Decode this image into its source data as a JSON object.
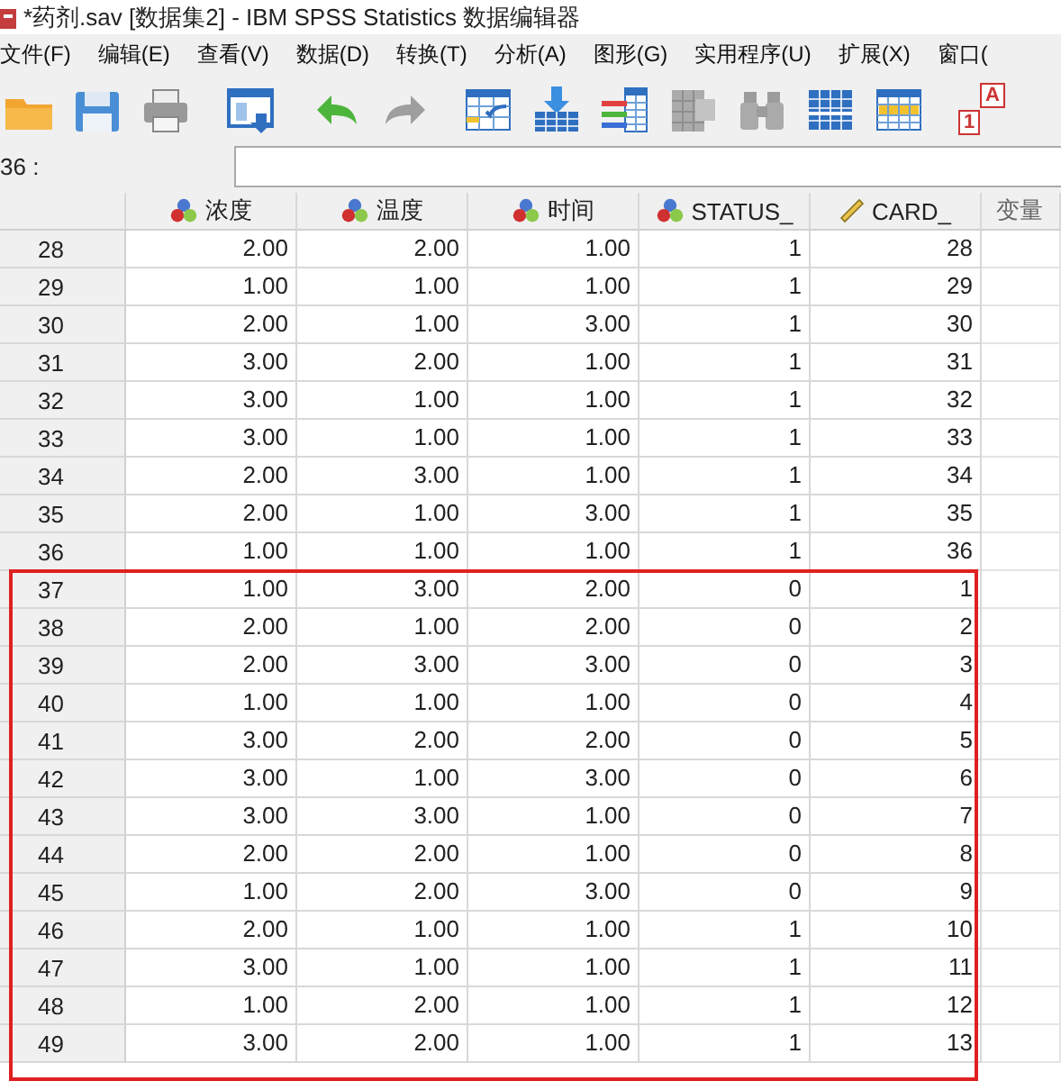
{
  "window": {
    "title": "*药剂.sav [数据集2] - IBM SPSS Statistics 数据编辑器"
  },
  "menu": [
    "文件(F)",
    "编辑(E)",
    "查看(V)",
    "数据(D)",
    "转换(T)",
    "分析(A)",
    "图形(G)",
    "实用程序(U)",
    "扩展(X)",
    "窗口("
  ],
  "toolbar": [
    {
      "kind": "folder",
      "disabled": false
    },
    {
      "kind": "save",
      "disabled": false
    },
    {
      "kind": "print",
      "disabled": false
    },
    {
      "kind": "dialog",
      "disabled": false
    },
    {
      "kind": "undo",
      "disabled": false
    },
    {
      "kind": "redo",
      "disabled": true
    },
    {
      "kind": "goto-case",
      "disabled": false
    },
    {
      "kind": "goto-variable",
      "disabled": false
    },
    {
      "kind": "variables",
      "disabled": false
    },
    {
      "kind": "grid",
      "disabled": true
    },
    {
      "kind": "binoculars",
      "disabled": true
    },
    {
      "kind": "split-table",
      "disabled": false
    },
    {
      "kind": "select-table",
      "disabled": false
    },
    {
      "kind": "value-labels",
      "disabled": false,
      "labels": [
        "A",
        "1"
      ]
    }
  ],
  "cell_editor": {
    "label": "36 :"
  },
  "table": {
    "columns": [
      {
        "name": "浓度",
        "kind": "nominal"
      },
      {
        "name": "温度",
        "kind": "nominal"
      },
      {
        "name": "时间",
        "kind": "nominal"
      },
      {
        "name": "STATUS_",
        "kind": "nominal"
      },
      {
        "name": "CARD_",
        "kind": "scale"
      },
      {
        "name": "变量"
      }
    ],
    "rows": [
      {
        "n": "28",
        "cells": [
          "2.00",
          "2.00",
          "1.00",
          "1",
          "28"
        ],
        "highlighted": false
      },
      {
        "n": "29",
        "cells": [
          "1.00",
          "1.00",
          "1.00",
          "1",
          "29"
        ],
        "highlighted": false
      },
      {
        "n": "30",
        "cells": [
          "2.00",
          "1.00",
          "3.00",
          "1",
          "30"
        ],
        "highlighted": false
      },
      {
        "n": "31",
        "cells": [
          "3.00",
          "2.00",
          "1.00",
          "1",
          "31"
        ],
        "highlighted": false
      },
      {
        "n": "32",
        "cells": [
          "3.00",
          "1.00",
          "1.00",
          "1",
          "32"
        ],
        "highlighted": false
      },
      {
        "n": "33",
        "cells": [
          "3.00",
          "1.00",
          "1.00",
          "1",
          "33"
        ],
        "highlighted": false
      },
      {
        "n": "34",
        "cells": [
          "2.00",
          "3.00",
          "1.00",
          "1",
          "34"
        ],
        "highlighted": false
      },
      {
        "n": "35",
        "cells": [
          "2.00",
          "1.00",
          "3.00",
          "1",
          "35"
        ],
        "highlighted": false
      },
      {
        "n": "36",
        "cells": [
          "1.00",
          "1.00",
          "1.00",
          "1",
          "36"
        ],
        "highlighted": false
      },
      {
        "n": "37",
        "cells": [
          "1.00",
          "3.00",
          "2.00",
          "0",
          "1"
        ],
        "highlighted": true
      },
      {
        "n": "38",
        "cells": [
          "2.00",
          "1.00",
          "2.00",
          "0",
          "2"
        ],
        "highlighted": true
      },
      {
        "n": "39",
        "cells": [
          "2.00",
          "3.00",
          "3.00",
          "0",
          "3"
        ],
        "highlighted": true
      },
      {
        "n": "40",
        "cells": [
          "1.00",
          "1.00",
          "1.00",
          "0",
          "4"
        ],
        "highlighted": true
      },
      {
        "n": "41",
        "cells": [
          "3.00",
          "2.00",
          "2.00",
          "0",
          "5"
        ],
        "highlighted": true
      },
      {
        "n": "42",
        "cells": [
          "3.00",
          "1.00",
          "3.00",
          "0",
          "6"
        ],
        "highlighted": true
      },
      {
        "n": "43",
        "cells": [
          "3.00",
          "3.00",
          "1.00",
          "0",
          "7"
        ],
        "highlighted": true
      },
      {
        "n": "44",
        "cells": [
          "2.00",
          "2.00",
          "1.00",
          "0",
          "8"
        ],
        "highlighted": true
      },
      {
        "n": "45",
        "cells": [
          "1.00",
          "2.00",
          "3.00",
          "0",
          "9"
        ],
        "highlighted": true
      },
      {
        "n": "46",
        "cells": [
          "2.00",
          "1.00",
          "1.00",
          "1",
          "10"
        ],
        "highlighted": true
      },
      {
        "n": "47",
        "cells": [
          "3.00",
          "1.00",
          "1.00",
          "1",
          "11"
        ],
        "highlighted": true
      },
      {
        "n": "48",
        "cells": [
          "1.00",
          "2.00",
          "1.00",
          "1",
          "12"
        ],
        "highlighted": true
      },
      {
        "n": "49",
        "cells": [
          "3.00",
          "2.00",
          "1.00",
          "1",
          "13"
        ],
        "highlighted": true
      }
    ]
  }
}
